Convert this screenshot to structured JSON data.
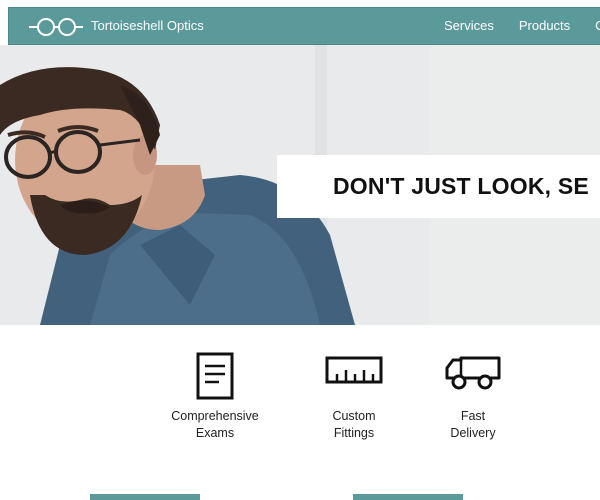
{
  "header": {
    "brand": "Tortoiseshell Optics",
    "nav": [
      {
        "label": "Services"
      },
      {
        "label": "Products"
      },
      {
        "label": "C"
      }
    ]
  },
  "hero": {
    "tagline": "DON'T JUST LOOK, SE",
    "image": "man-with-glasses-photo"
  },
  "features": [
    {
      "icon": "document-icon",
      "line1": "Comprehensive",
      "line2": "Exams"
    },
    {
      "icon": "ruler-icon",
      "line1": "Custom",
      "line2": "Fittings"
    },
    {
      "icon": "truck-icon",
      "line1": "Fast",
      "line2": "Delivery"
    }
  ],
  "colors": {
    "accent": "#5b9a9b",
    "text": "#111111"
  }
}
